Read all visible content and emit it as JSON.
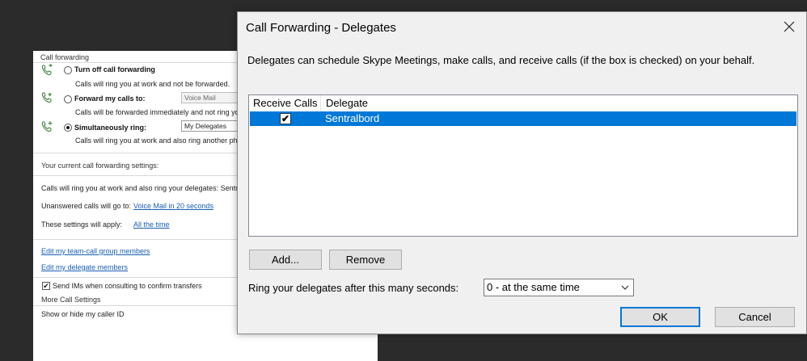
{
  "background_window": {
    "section_call_forwarding": "Call forwarding",
    "options": [
      {
        "label": "Turn off call forwarding",
        "description": "Calls will ring you at work and not be forwarded.",
        "selected": false
      },
      {
        "label": "Forward my calls to:",
        "description": "Calls will be forwarded immediately and not ring you",
        "selected": false,
        "combo_value": "Voice Mail"
      },
      {
        "label": "Simultaneously ring:",
        "description": "Calls will ring you at work and also ring another pho",
        "selected": true,
        "combo_value": "My Delegates"
      }
    ],
    "current_settings_title": "Your current call forwarding settings:",
    "current_summary": "Calls will ring you at work  and also ring your delegates: Sentra",
    "unanswered_label": "Unanswered calls will go to:",
    "unanswered_link": "Voice Mail in 20 seconds",
    "apply_label": "These settings will apply:",
    "apply_link": "All the time",
    "edit_team_link": "Edit my team-call group members",
    "edit_delegate_link": "Edit my delegate members",
    "send_ims_label": "Send IMs when consulting to confirm transfers",
    "send_ims_checked": true,
    "more_settings_title": "More Call Settings",
    "caller_id_label": "Show or hide my caller ID"
  },
  "dialog": {
    "title": "Call Forwarding - Delegates",
    "close_icon": "close-icon",
    "intro": "Delegates can schedule Skype Meetings, make calls, and receive calls (if the box is checked) on your behalf.",
    "columns": [
      "Receive Calls",
      "Delegate"
    ],
    "rows": [
      {
        "receive_calls": true,
        "delegate": "Sentralbord",
        "selected": true
      }
    ],
    "add_button": "Add...",
    "remove_button": "Remove",
    "ring_label": "Ring your delegates after this many seconds:",
    "ring_value": "0 - at the same time",
    "ok_button": "OK",
    "cancel_button": "Cancel"
  },
  "colors": {
    "selection": "#0078d7",
    "link": "#1a5fb4",
    "backdrop": "#2b2b2b"
  }
}
